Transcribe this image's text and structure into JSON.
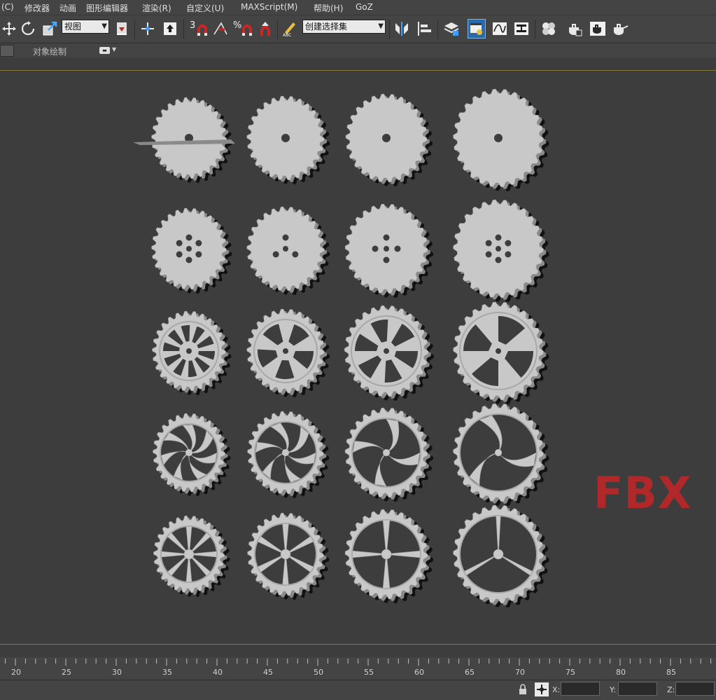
{
  "menubar": {
    "items": [
      "(C)",
      "修改器",
      "动画",
      "图形编辑器",
      "渲染(R)",
      "自定义(U)",
      "MAXScript(M)",
      "帮助(H)",
      "GoZ"
    ]
  },
  "toolbar": {
    "view_dropdown": "视图",
    "snap_label": "3",
    "percent_label": "%",
    "selection_set_dropdown": "创建选择集",
    "icons": [
      "move-icon",
      "rotate-icon",
      "scale-icon",
      "pivot-icon",
      "manipulate-icon",
      "snap-icon",
      "angle-snap-icon",
      "percent-snap-icon",
      "spinner-snap-icon",
      "edit-named-sets-icon",
      "mirror-icon",
      "align-icon",
      "layer-manager-icon",
      "scene-explorer-icon",
      "curve-editor-icon",
      "schematic-view-icon",
      "material-editor-icon",
      "render-setup-icon",
      "render-frame-icon",
      "render-production-icon"
    ]
  },
  "ribbon": {
    "label": "对象绘制"
  },
  "viewport": {
    "watermark": "FBX",
    "watermark_color": "#b0282a",
    "gear_color": "#c8c8c8",
    "background_color": "#3d3d3d"
  },
  "timeline": {
    "ticks": [
      "20",
      "25",
      "30",
      "35",
      "40",
      "45",
      "50",
      "55",
      "60",
      "65",
      "70",
      "75",
      "80",
      "85"
    ]
  },
  "statusbar": {
    "x_label": "X:",
    "y_label": "Y:",
    "z_label": "Z:"
  }
}
